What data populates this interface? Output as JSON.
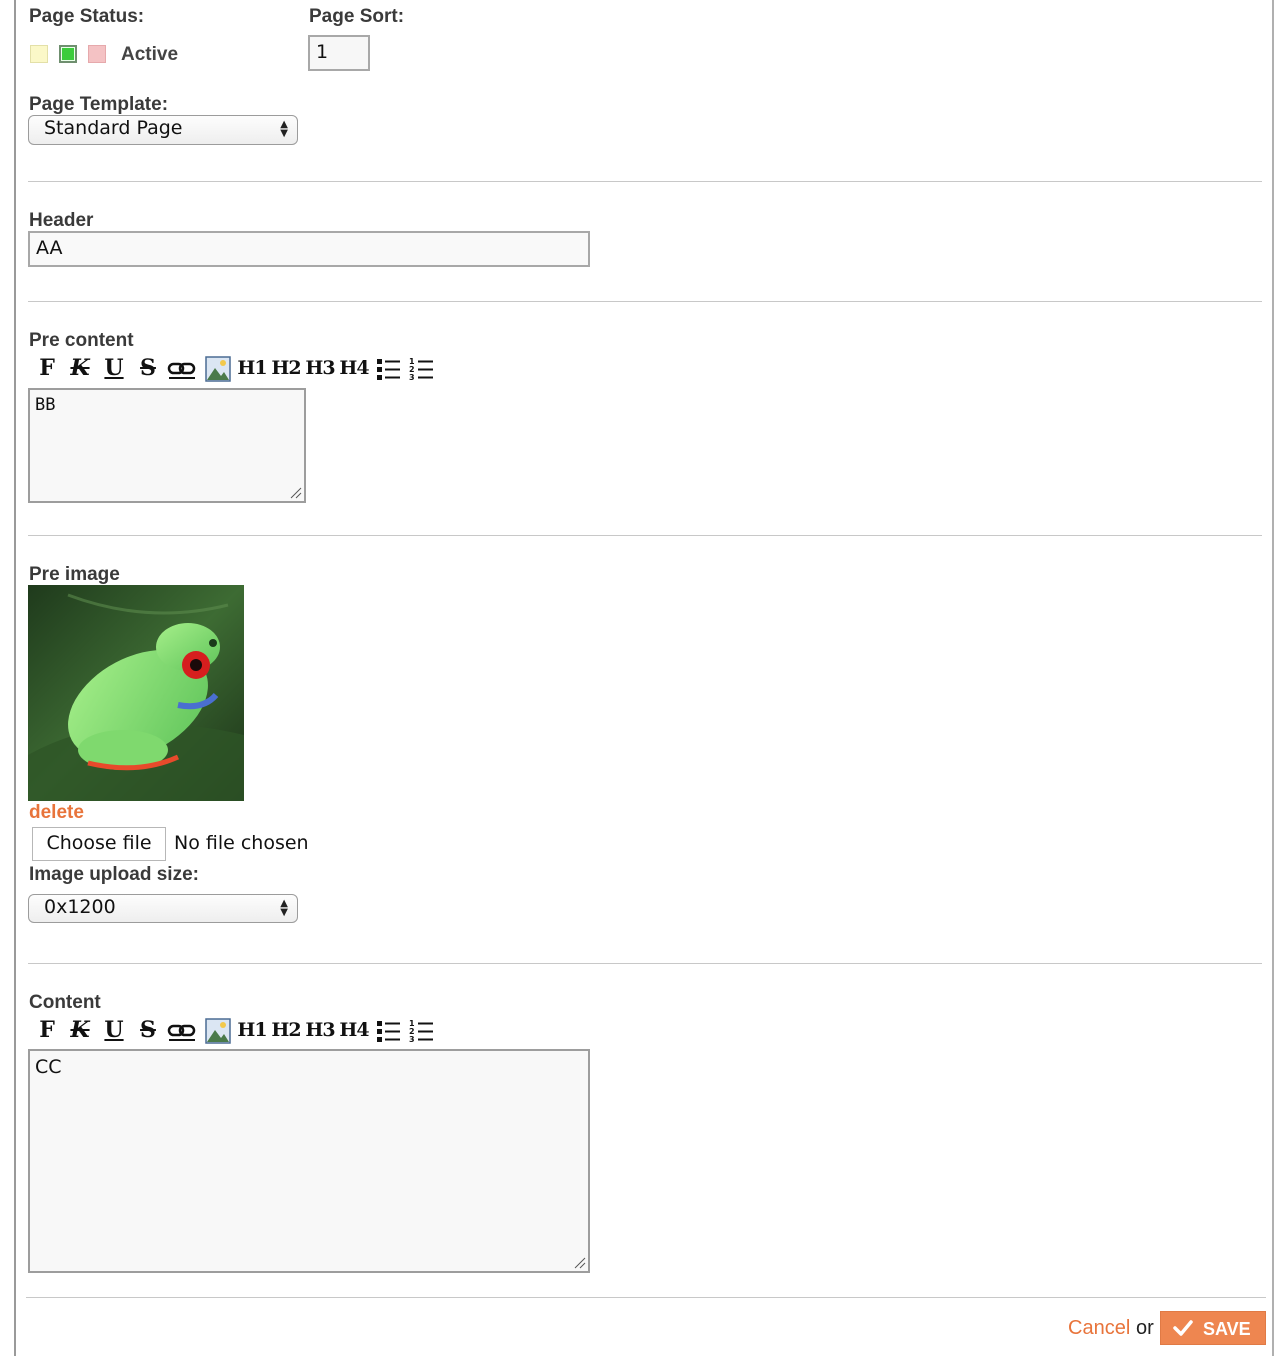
{
  "page_status": {
    "label": "Page Status:",
    "value": "Active",
    "swatch_colors": [
      "#fbf8c8",
      "#3ccc3c",
      "#f4c2c4"
    ]
  },
  "page_sort": {
    "label": "Page Sort:",
    "value": "1"
  },
  "page_template": {
    "label": "Page Template:",
    "selected": "Standard Page"
  },
  "header": {
    "label": "Header",
    "value": "AA"
  },
  "pre_content": {
    "label": "Pre content",
    "value": "BB"
  },
  "editor_toolbar": {
    "buttons": [
      "bold",
      "italic",
      "underline",
      "strikethrough",
      "link",
      "image",
      "h1",
      "h2",
      "h3",
      "h4",
      "bullet-list",
      "numbered-list"
    ],
    "bold": "F",
    "italic": "K",
    "underline": "U",
    "strike": "S",
    "h1": "H1",
    "h2": "H2",
    "h3": "H3",
    "h4": "H4"
  },
  "pre_image": {
    "label": "Pre image",
    "delete_label": "delete",
    "choose_file": "Choose file",
    "no_file": "No file chosen"
  },
  "image_upload_size": {
    "label": "Image upload size:",
    "selected": "0x1200"
  },
  "content": {
    "label": "Content",
    "value": "CC"
  },
  "actions": {
    "cancel": "Cancel",
    "or": "or",
    "save": "SAVE"
  },
  "colors": {
    "accent": "#ee8650",
    "link": "#e8743b"
  }
}
